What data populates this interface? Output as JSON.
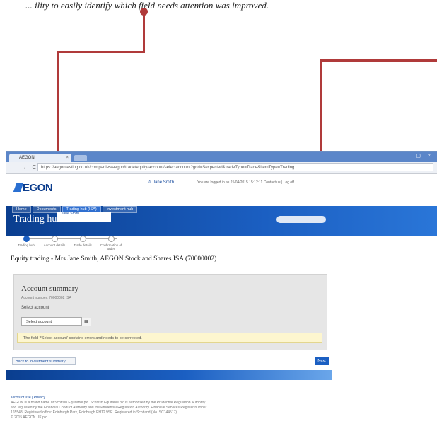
{
  "caption": "... ility to easily identify which field needs attention was improved.",
  "browser": {
    "tab_title": "AEGON",
    "window_controls": "– ▢ ×",
    "nav_glyphs": "← → C",
    "url": "https://aegontesting.co.uk/companies/aegon/trade/equity/account/selectaccount?grid=Sexpected&tradeType=Trade&itemType=Trading"
  },
  "header": {
    "logo_text": "EGON",
    "user_name": "Jane Smith",
    "login_info": "You are logged in as 25/04/2015 15:12:11   Contact us   |   Log off",
    "nav_tabs": [
      "Home",
      "Documents",
      "Trading hub (ISA)",
      "Investment hub"
    ],
    "hub_title": "Trading hub",
    "client_chip": "Jane Smith"
  },
  "steps": [
    {
      "label": "Trading hub"
    },
    {
      "label": "Account details"
    },
    {
      "label": "Trade details"
    },
    {
      "label": "Confirmation of order"
    }
  ],
  "main": {
    "heading": "Equity trading - Mrs Jane Smith, AEGON Stock and Shares ISA (70000002)",
    "panel_title": "Account summary",
    "panel_sub": "Account number: 70000002 ISA",
    "select_label": "Select account",
    "select_value": "Select account",
    "warning": "The field '*Select account' contains errors and needs to be corrected.",
    "back_button": "Back to investment summary",
    "next_button": "Next"
  },
  "footer": {
    "links": "Terms of use  |  Privacy",
    "line1": "AEGON is a brand name of Scottish Equitable plc. Scottish Equitable plc is authorised by the Prudential Regulation Authority",
    "line2": "and regulated by the Financial Conduct Authority and the Prudential Regulation Authority. Financial Services Register number",
    "line3": "165548. Registered office: Edinburgh Park, Edinburgh EH12 9SE. Registered in Scotland (No. SC144517).",
    "line4": "© 2015 AEGON UK plc"
  }
}
